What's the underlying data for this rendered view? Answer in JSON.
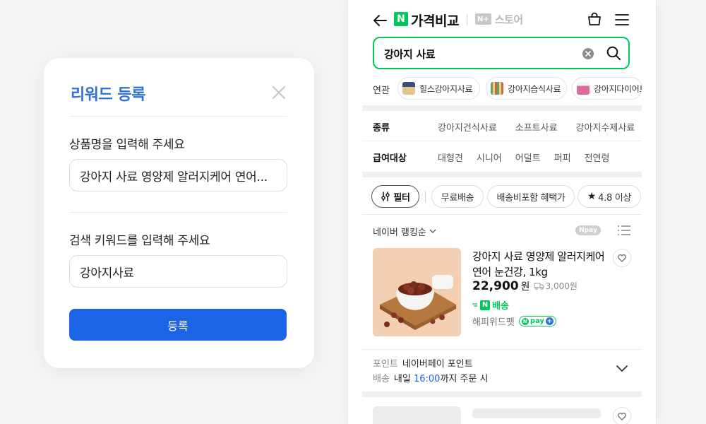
{
  "modal": {
    "title": "리워드 등록",
    "product_label": "상품명을 입력해 주세요",
    "product_value": "강아지 사료 영양제 알러지케어 연어...",
    "keyword_label": "검색 키워드를 입력해 주세요",
    "keyword_value": "강아지사료",
    "submit_label": "등록"
  },
  "header": {
    "logo_letter": "N",
    "logo_text": "가격비교",
    "store_box": "N+",
    "store_text": "스토어"
  },
  "search": {
    "query": "강아지 사료"
  },
  "related": {
    "label": "연관",
    "items": [
      "힐스강아지사료",
      "강아지습식사료",
      "강아지다이어트"
    ]
  },
  "filters": [
    {
      "key": "종류",
      "options": [
        "강아지건식사료",
        "소프트사료",
        "강아지수제사료"
      ]
    },
    {
      "key": "급여대상",
      "options": [
        "대형견",
        "시니어",
        "어덜트",
        "퍼피",
        "전연령"
      ]
    }
  ],
  "pills": {
    "filter": "필터",
    "free_shipping": "무료배송",
    "shipping_benefit": "배송비포함 혜택가",
    "rating": "4.8 이상"
  },
  "sort": {
    "label": "네이버 랭킹순",
    "npay": "Npay"
  },
  "product": {
    "title": "강아지 사료 영양제 알러지케어 연어 눈건강, 1kg",
    "price": "22,900",
    "currency": "원",
    "ship_fee": "3,000원",
    "delivery": "배송",
    "seller": "해피위드펫",
    "npay_plus": "pay"
  },
  "delivery_info": {
    "point_key": "포인트",
    "point_value": "네이버페이 포인트",
    "ship_key": "배송",
    "ship_pre": "내일",
    "ship_time": "16:00",
    "ship_post": "까지 주문 시"
  },
  "colors": {
    "brand_green": "#03c75a",
    "primary_blue": "#1b64e5",
    "title_blue": "#2f6fd6"
  }
}
